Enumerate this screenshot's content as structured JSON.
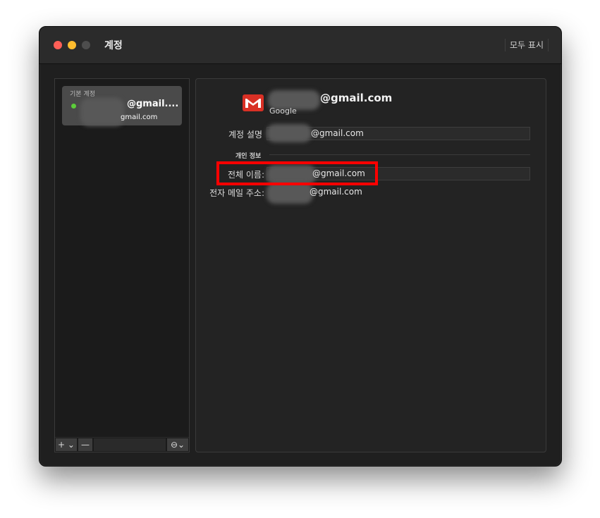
{
  "window": {
    "title": "계정",
    "show_all_label": "모두 표시"
  },
  "sidebar": {
    "section_label": "기본 계정",
    "account": {
      "name": "@gmail....",
      "email": "gmail.com",
      "status_color": "#5ccd3a"
    },
    "toolbar": {
      "add_label": "+ ⌄",
      "remove_label": "—",
      "more_label": "⊖⌄"
    }
  },
  "detail": {
    "header_email": "@gmail.com",
    "provider": "Google",
    "account_description": {
      "label": "계정 설명",
      "value": "@gmail.com"
    },
    "personal_info_heading": "개인 정보",
    "full_name": {
      "label": "전체 이름:",
      "value": "@gmail.com"
    },
    "email_address": {
      "label": "전자 메일 주소:",
      "value": "@gmail.com"
    }
  },
  "colors": {
    "highlight": "#ff0000",
    "gmail_red": "#d93025"
  }
}
